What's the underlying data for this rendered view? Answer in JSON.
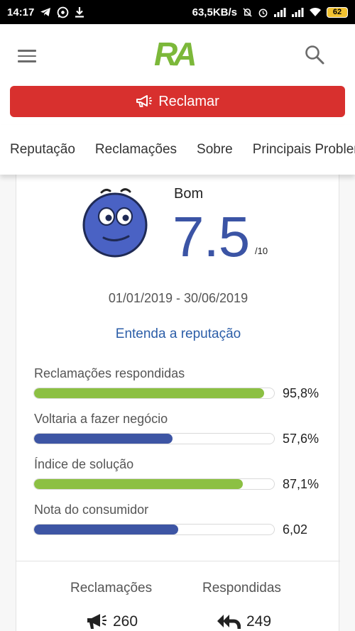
{
  "status_bar": {
    "time": "14:17",
    "network_speed": "63,5KB/s",
    "battery": "62"
  },
  "header": {
    "logo_text": "RA"
  },
  "actions": {
    "reclamar_label": "Reclamar"
  },
  "tabs": [
    {
      "label": "Reputação"
    },
    {
      "label": "Reclamações"
    },
    {
      "label": "Sobre"
    },
    {
      "label": "Principais Problemas"
    }
  ],
  "reputation": {
    "status": "Bom",
    "score": "7.5",
    "score_max": "/10",
    "period": "01/01/2019 - 30/06/2019",
    "link_label": "Entenda a reputação"
  },
  "colors": {
    "green_bar": "#8cc043",
    "blue_bar": "#3d55a4",
    "accent_red": "#d8302e",
    "score_blue": "#3b54a5"
  },
  "metrics": [
    {
      "label": "Reclamações respondidas",
      "value": "95,8%",
      "fill": 0.958,
      "color": "green"
    },
    {
      "label": "Voltaria a fazer negócio",
      "value": "57,6%",
      "fill": 0.576,
      "color": "blue"
    },
    {
      "label": "Índice de solução",
      "value": "87,1%",
      "fill": 0.871,
      "color": "green"
    },
    {
      "label": "Nota do consumidor",
      "value": "6,02",
      "fill": 0.602,
      "color": "blue"
    }
  ],
  "stats": {
    "reclamacoes_title": "Reclamações",
    "reclamacoes_value": "260",
    "respondidas_title": "Respondidas",
    "respondidas_value": "249"
  }
}
